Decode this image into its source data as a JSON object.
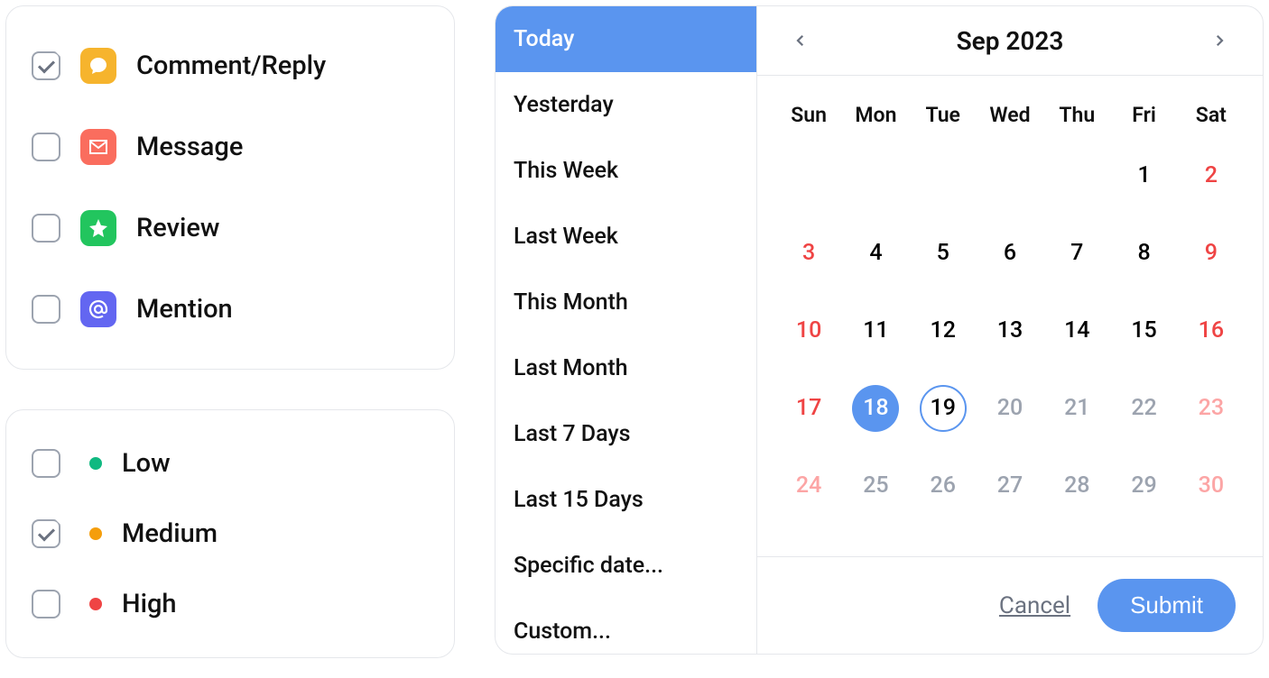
{
  "typeFilters": [
    {
      "id": "comment",
      "label": "Comment/Reply",
      "checked": true,
      "iconColor": "#f6b42d",
      "iconName": "comment-icon"
    },
    {
      "id": "message",
      "label": "Message",
      "checked": false,
      "iconColor": "#fa6d5e",
      "iconName": "envelope-icon"
    },
    {
      "id": "review",
      "label": "Review",
      "checked": false,
      "iconColor": "#22c55e",
      "iconName": "star-icon"
    },
    {
      "id": "mention",
      "label": "Mention",
      "checked": false,
      "iconColor": "#6366f1",
      "iconName": "at-icon"
    }
  ],
  "priorities": [
    {
      "id": "low",
      "label": "Low",
      "checked": false,
      "color": "green"
    },
    {
      "id": "medium",
      "label": "Medium",
      "checked": true,
      "color": "yellow"
    },
    {
      "id": "high",
      "label": "High",
      "checked": false,
      "color": "red"
    }
  ],
  "datePresets": [
    {
      "label": "Today",
      "active": true
    },
    {
      "label": "Yesterday",
      "active": false
    },
    {
      "label": "This Week",
      "active": false
    },
    {
      "label": "Last Week",
      "active": false
    },
    {
      "label": "This Month",
      "active": false
    },
    {
      "label": "Last Month",
      "active": false
    },
    {
      "label": "Last 7 Days",
      "active": false
    },
    {
      "label": "Last 15 Days",
      "active": false
    },
    {
      "label": "Specific date...",
      "active": false
    },
    {
      "label": "Custom...",
      "active": false
    }
  ],
  "calendar": {
    "monthLabel": "Sep 2023",
    "dow": [
      "Sun",
      "Mon",
      "Tue",
      "Wed",
      "Thu",
      "Fri",
      "Sat"
    ],
    "days": [
      {
        "n": "",
        "weekend": false,
        "muted": false
      },
      {
        "n": "",
        "weekend": false,
        "muted": false
      },
      {
        "n": "",
        "weekend": false,
        "muted": false
      },
      {
        "n": "",
        "weekend": false,
        "muted": false
      },
      {
        "n": "",
        "weekend": false,
        "muted": false
      },
      {
        "n": "1",
        "weekend": false,
        "muted": false
      },
      {
        "n": "2",
        "weekend": true,
        "muted": false
      },
      {
        "n": "3",
        "weekend": true,
        "muted": false
      },
      {
        "n": "4",
        "weekend": false,
        "muted": false
      },
      {
        "n": "5",
        "weekend": false,
        "muted": false
      },
      {
        "n": "6",
        "weekend": false,
        "muted": false
      },
      {
        "n": "7",
        "weekend": false,
        "muted": false
      },
      {
        "n": "8",
        "weekend": false,
        "muted": false
      },
      {
        "n": "9",
        "weekend": true,
        "muted": false
      },
      {
        "n": "10",
        "weekend": true,
        "muted": false
      },
      {
        "n": "11",
        "weekend": false,
        "muted": false
      },
      {
        "n": "12",
        "weekend": false,
        "muted": false
      },
      {
        "n": "13",
        "weekend": false,
        "muted": false
      },
      {
        "n": "14",
        "weekend": false,
        "muted": false
      },
      {
        "n": "15",
        "weekend": false,
        "muted": false
      },
      {
        "n": "16",
        "weekend": true,
        "muted": false
      },
      {
        "n": "17",
        "weekend": true,
        "muted": false
      },
      {
        "n": "18",
        "weekend": false,
        "muted": false,
        "selected": true
      },
      {
        "n": "19",
        "weekend": false,
        "muted": false,
        "today": true
      },
      {
        "n": "20",
        "weekend": false,
        "muted": true
      },
      {
        "n": "21",
        "weekend": false,
        "muted": true
      },
      {
        "n": "22",
        "weekend": false,
        "muted": true
      },
      {
        "n": "23",
        "weekend": true,
        "muted": true
      },
      {
        "n": "24",
        "weekend": true,
        "muted": true
      },
      {
        "n": "25",
        "weekend": false,
        "muted": true
      },
      {
        "n": "26",
        "weekend": false,
        "muted": true
      },
      {
        "n": "27",
        "weekend": false,
        "muted": true
      },
      {
        "n": "28",
        "weekend": false,
        "muted": true
      },
      {
        "n": "29",
        "weekend": false,
        "muted": true
      },
      {
        "n": "30",
        "weekend": true,
        "muted": true
      }
    ],
    "actions": {
      "cancel": "Cancel",
      "submit": "Submit"
    }
  }
}
